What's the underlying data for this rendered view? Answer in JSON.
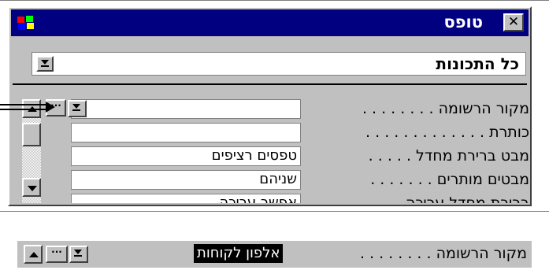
{
  "window": {
    "title": "טופס",
    "close_glyph": "✕"
  },
  "selector": {
    "value": "כל התכונות"
  },
  "properties": [
    {
      "label": "מקור הרשומה . . . . . . . .",
      "value": ""
    },
    {
      "label": "כותרת . . . . . . . . . . . . .",
      "value": ""
    },
    {
      "label": "מבט ברירת מחדל . . . . .",
      "value": "טפסים רציפים"
    },
    {
      "label": "מבטים מותרים . . . . . . .",
      "value": "שניהם"
    },
    {
      "label": "ברירת מחדל עריכה",
      "value": "אפשר עריכה"
    }
  ],
  "bottom_strip": {
    "label": "מקור הרשומה . . . . . . . .",
    "value": "אלפון לקוחות",
    "builder_glyph": "···"
  },
  "icons": {
    "app": "access-form-icon",
    "dropdown": "dropdown-arrow-icon",
    "builder": "builder-ellipsis-icon",
    "scroll_up": "scroll-up-arrow-icon",
    "scroll_down": "scroll-down-arrow-icon",
    "pointer": "double-arrow-pointer-icon"
  },
  "colors": {
    "titlebar": "#000080",
    "face": "#c0c0c0",
    "highlight": "#000000"
  }
}
